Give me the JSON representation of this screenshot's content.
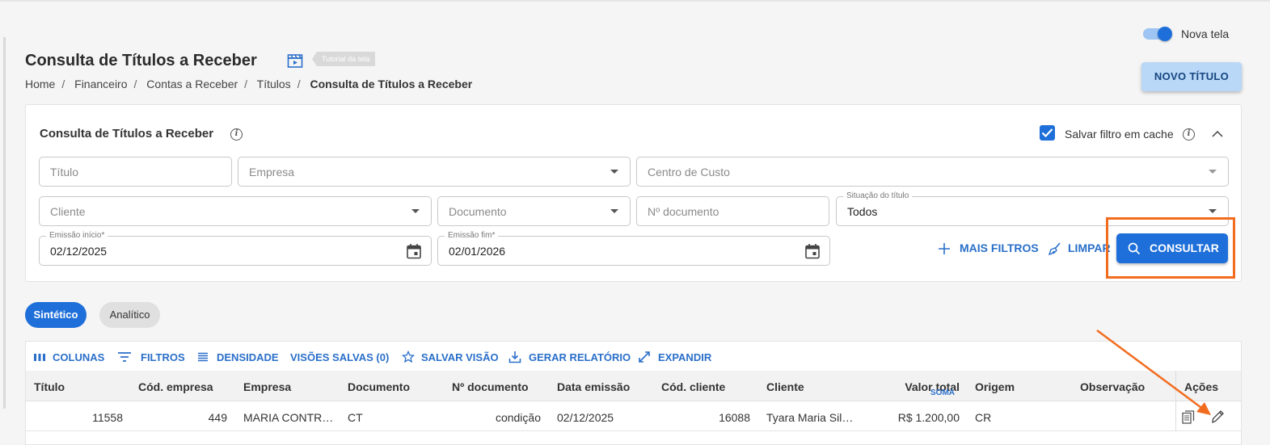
{
  "header": {
    "toggle_label": "Nova tela",
    "title": "Consulta de Títulos a Receber",
    "tutorial_badge": "Tutorial da tela",
    "new_button": "NOVO TÍTULO",
    "breadcrumb": [
      "Home",
      "Financeiro",
      "Contas a Receber",
      "Títulos",
      "Consulta de Títulos a Receber"
    ]
  },
  "filters": {
    "title": "Consulta de Títulos a Receber",
    "save_cache_label": "Salvar filtro em cache",
    "save_cache_checked": true,
    "titulo_placeholder": "Título",
    "empresa_placeholder": "Empresa",
    "centro_custo_placeholder": "Centro de Custo",
    "cliente_placeholder": "Cliente",
    "documento_placeholder": "Documento",
    "n_documento_placeholder": "Nº documento",
    "situacao_label": "Situação do título",
    "situacao_value": "Todos",
    "emissao_inicio_label": "Emissão início*",
    "emissao_inicio_value": "02/12/2025",
    "emissao_fim_label": "Emissão fim*",
    "emissao_fim_value": "02/01/2026",
    "mais_filtros": "MAIS FILTROS",
    "limpar": "LIMPAR",
    "consultar": "CONSULTAR"
  },
  "view_tabs": {
    "sintetico": "Sintético",
    "analitico": "Analítico",
    "active": "Sintético"
  },
  "toolbar": {
    "colunas": "COLUNAS",
    "filtros": "FILTROS",
    "densidade": "DENSIDADE",
    "visoes_salvas": "VISÕES SALVAS (0)",
    "salvar_visao": "SALVAR VISÃO",
    "gerar_relatorio": "GERAR RELATÓRIO",
    "expandir": "EXPANDIR"
  },
  "table": {
    "columns": [
      "Título",
      "Cód. empresa",
      "Empresa",
      "Documento",
      "Nº documento",
      "Data emissão",
      "Cód. cliente",
      "Cliente",
      "Valor total",
      "Origem",
      "Observação",
      "Ações"
    ],
    "soma_label": "SOMA",
    "rows": [
      {
        "titulo": "11558",
        "cod_empresa": "449",
        "empresa": "MARIA CONTR…",
        "documento": "CT",
        "n_documento": "condição",
        "data_emissao": "02/12/2025",
        "cod_cliente": "16088",
        "cliente": "Tyara Maria Sil…",
        "valor_total": "R$ 1.200,00",
        "origem": "CR",
        "observacao": ""
      }
    ]
  },
  "colors": {
    "primary": "#1e6fd9",
    "link": "#2a6fc9",
    "highlight": "#f26c1f",
    "new_button_bg": "#b9d8f8"
  },
  "icons": {
    "tutorial": "clapperboard-icon",
    "info": "info-icon",
    "collapse": "chevron-up-icon",
    "calendar": "calendar-icon",
    "add": "plus-icon",
    "clear": "broom-icon",
    "search": "search-icon",
    "copy": "copy-icon",
    "edit": "pencil-icon"
  }
}
